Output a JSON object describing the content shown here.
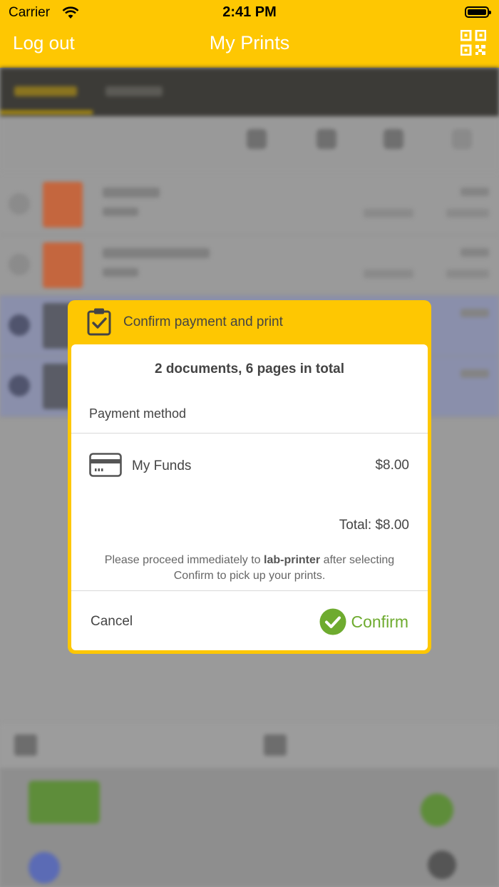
{
  "status_bar": {
    "carrier": "Carrier",
    "time": "2:41 PM"
  },
  "nav": {
    "logout_label": "Log out",
    "title": "My Prints",
    "qr_icon": "qr-code-icon"
  },
  "dialog": {
    "title": "Confirm payment and print",
    "summary": "2 documents, 6 pages in total",
    "payment_method_label": "Payment method",
    "method": {
      "icon": "credit-card-icon",
      "name": "My Funds",
      "amount": "$8.00"
    },
    "total": "Total: $8.00",
    "notice_before": "Please proceed immediately to ",
    "notice_printer": "lab-printer",
    "notice_after": " after selecting Confirm to pick up your prints.",
    "cancel_label": "Cancel",
    "confirm_label": "Confirm"
  },
  "colors": {
    "brand": "#fec702",
    "confirm_green": "#6eab2f"
  }
}
